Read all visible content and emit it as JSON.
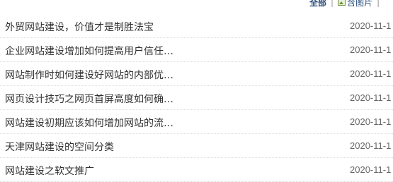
{
  "filter": {
    "all_label": "全部",
    "pic_label": "含图片",
    "extra_label": "|"
  },
  "news": [
    {
      "title": "外贸网站建设，价值才是制胜法宝",
      "date": "2020-11-1"
    },
    {
      "title": "企业网站建设增加如何提高用户信任…",
      "date": "2020-11-1"
    },
    {
      "title": "网站制作时如何建设好网站的内部优…",
      "date": "2020-11-1"
    },
    {
      "title": "网页设计技巧之网页首屏高度如何确…",
      "date": "2020-11-1"
    },
    {
      "title": "网站建设初期应该如何增加网站的流…",
      "date": "2020-11-1"
    },
    {
      "title": "天津网站建设的空间分类",
      "date": "2020-11-1"
    },
    {
      "title": "网站建设之软文推广",
      "date": "2020-11-1"
    }
  ]
}
